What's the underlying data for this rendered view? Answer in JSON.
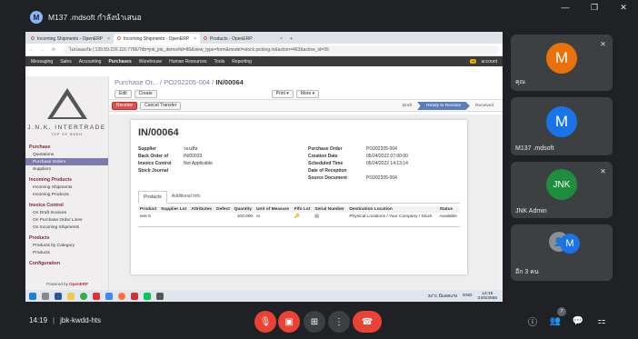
{
  "meet": {
    "title": "M137 .mdsoft กำลังนำเสนอ",
    "avatar_letter": "M",
    "window": {
      "minimize": "—",
      "restore": "❐",
      "close": "✕"
    },
    "clock": "14:19",
    "meeting_code": "jbk-kwdd-hts",
    "participants_count": "7",
    "colors": {
      "background": "#202124",
      "tile": "#3c4043",
      "danger": "#ea4335"
    }
  },
  "browser": {
    "tabs": [
      {
        "title": "Incoming Shipments - OpenERP"
      },
      {
        "title": "Incoming Shipments - OpenERP"
      },
      {
        "title": "Products - OpenERP"
      }
    ],
    "nav": "← → ⟳",
    "url": "ไม่ปลอดภัย | 139.59.226.116:7786/?db=jnk_jnk_demo#id=86&view_type=form&model=stock.picking.in&action=463&active_id=55"
  },
  "erp": {
    "menu": [
      "Messaging",
      "Sales",
      "Accounting",
      "Purchases",
      "Warehouse",
      "Human Resources",
      "Tools",
      "Reporting"
    ],
    "user": "account",
    "company": {
      "name": "J.N.K. INTERTRADE",
      "tagline": "TOP OF REEH"
    },
    "sidebar": [
      {
        "section": "Purchase",
        "items": [
          {
            "label": "Quotations"
          },
          {
            "label": "Purchase Orders",
            "active": true
          },
          {
            "label": "Suppliers"
          }
        ]
      },
      {
        "section": "Incoming Products",
        "items": [
          {
            "label": "Incoming Shipments"
          },
          {
            "label": "Incoming Products"
          }
        ]
      },
      {
        "section": "Invoice Control",
        "items": [
          {
            "label": "On Draft Invoices"
          },
          {
            "label": "On Purchase Order Lines"
          },
          {
            "label": "On Incoming Shipments"
          }
        ]
      },
      {
        "section": "Products",
        "items": [
          {
            "label": "Products by Category"
          },
          {
            "label": "Products"
          }
        ]
      },
      {
        "section": "Configuration",
        "items": []
      }
    ],
    "powered_by": "Powered by",
    "powered_brand": "OpenERP",
    "breadcrumb": {
      "a": "Purchase Or...",
      "b": "PO202205-004",
      "current": "IN/00064"
    },
    "buttons": {
      "edit": "Edit",
      "create": "Create",
      "print": "Print ▾",
      "more": "More ▾",
      "receive": "Receive",
      "cancel": "Cancel Transfer"
    },
    "status": {
      "draft": "Draft",
      "ready": "Ready to Receive",
      "received": "Received"
    },
    "doc": {
      "name": "IN/00064",
      "left": [
        {
          "label": "Supplier",
          "value": "ร่อนทิล"
        },
        {
          "label": "Back Order of",
          "value": "IN/00033"
        },
        {
          "label": "Invoice Control",
          "value": "Not Applicable"
        },
        {
          "label": "Stock Journal",
          "value": ""
        }
      ],
      "right": [
        {
          "label": "Purchase Order",
          "value": "PO202205-004"
        },
        {
          "label": "Creation Date",
          "value": "05/24/2022 07:00:00"
        },
        {
          "label": "Scheduled Time",
          "value": "05/24/2022 14:13:14"
        },
        {
          "label": "Date of Reception",
          "value": ""
        },
        {
          "label": "Source Document",
          "value": "PO202205-004"
        }
      ],
      "tabs": [
        "Products",
        "Additional Info"
      ],
      "columns": [
        "Product",
        "Supplier Lot",
        "Attributes",
        "Defect",
        "Quantity",
        "Unit of Measure",
        "Fifo Lot",
        "Serial Number",
        "Destination Location",
        "Status"
      ],
      "rows": [
        {
          "product": "test 5",
          "supplier_lot": "",
          "attributes": "",
          "defect": "",
          "quantity": "100.000",
          "uom": "m",
          "fifo": "",
          "serial": "",
          "dest": "Physical Locations / Your Company / Stock",
          "status": "Available"
        }
      ]
    }
  },
  "taskbar": {
    "weather": "32°C มีแดดแรง",
    "lang": "ENG",
    "time": "14:19",
    "date": "24/5/2565"
  },
  "tiles": [
    {
      "letter": "M",
      "color": "#e8710a",
      "name": "คุณ",
      "muted": true
    },
    {
      "letter": "M",
      "color": "#1a73e8",
      "name": "M137 .mdsoft",
      "muted": false
    },
    {
      "letter": "JNK",
      "color": "#1e8e3e",
      "name": "JNK Admin",
      "muted": true
    },
    {
      "letter": "M",
      "color": "#1a73e8",
      "name": "อีก 3 คน",
      "muted": false
    }
  ]
}
